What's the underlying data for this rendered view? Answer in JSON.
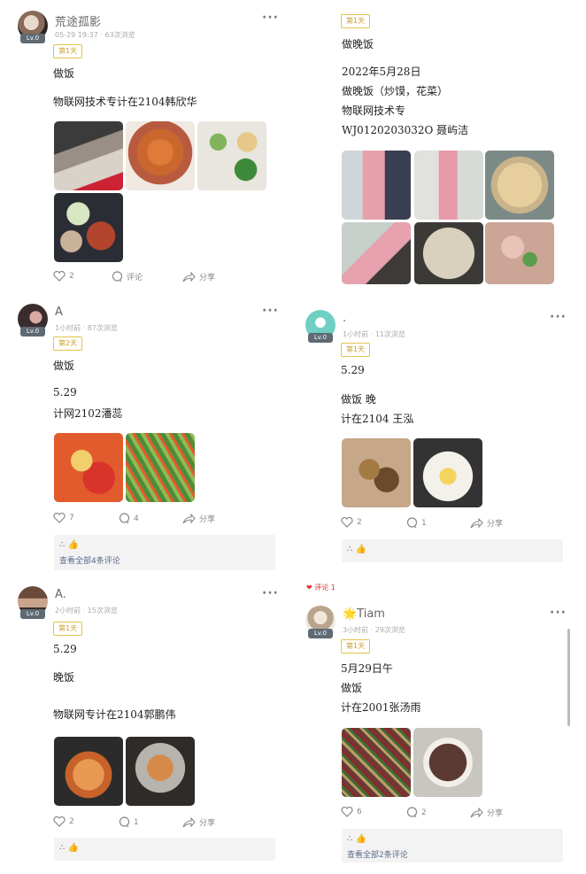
{
  "posts": {
    "p1": {
      "user": "荒途孤影",
      "meta": "05-29 19:37 · 63次浏览",
      "tag": "第1天",
      "lines": [
        "做饭",
        "物联网技术专计在2104韩欣华"
      ],
      "likes": "2",
      "comments": "评论",
      "share": "分享",
      "level": "Lv.0"
    },
    "p2": {
      "tag": "第1天",
      "lines": [
        "做晚饭",
        "2022年5月28日",
        "做晚饭（炒馍，花菜）",
        "物联网技术专",
        "WJ0120203032O 聂屿洁"
      ]
    },
    "p3": {
      "user": "A",
      "meta": "1小时前 · 87次浏览",
      "tag": "第2天",
      "lines": [
        "做饭",
        "5.29",
        "计网2102潘蕊"
      ],
      "likes": "7",
      "comments": "4",
      "share": "分享",
      "comment_like": "∴ 👍",
      "view_all": "查看全部4条评论",
      "level": "Lv.0"
    },
    "p4": {
      "user": ".",
      "meta": "1小时前 · 11次浏览",
      "tag": "第1天",
      "lines": [
        "5.29",
        "做饭 晚",
        "计在2104 王泓"
      ],
      "likes": "2",
      "comments": "1",
      "share": "分享",
      "comment_like": "∴ 👍",
      "level": "Lv.0"
    },
    "p5": {
      "user": "A.",
      "meta": "2小时前 · 15次浏览",
      "tag": "第1天",
      "lines": [
        "5.29",
        "晚饭",
        "物联网专计在2104郭鹏伟"
      ],
      "likes": "2",
      "comments": "1",
      "share": "分享",
      "comment_like": "∴ 👍",
      "level": "Lv.0"
    },
    "p6": {
      "user": "🌟Tiam",
      "meta": "3小时前 · 29次浏览",
      "tag": "第1天",
      "lines": [
        "5月29日午",
        "做饭",
        "计在2001张汤雨"
      ],
      "likes": "6",
      "comments": "2",
      "share": "分享",
      "comment_like": "∴ 👍",
      "view_all": "查看全部2条评论",
      "level": "Lv.0"
    }
  },
  "stray_text": "❤ 评论 1",
  "colors": {
    "tag_border": "#e2c34c",
    "tag_text": "#caa22a",
    "badge": "#5e6a74",
    "link": "#5a6b8c"
  }
}
